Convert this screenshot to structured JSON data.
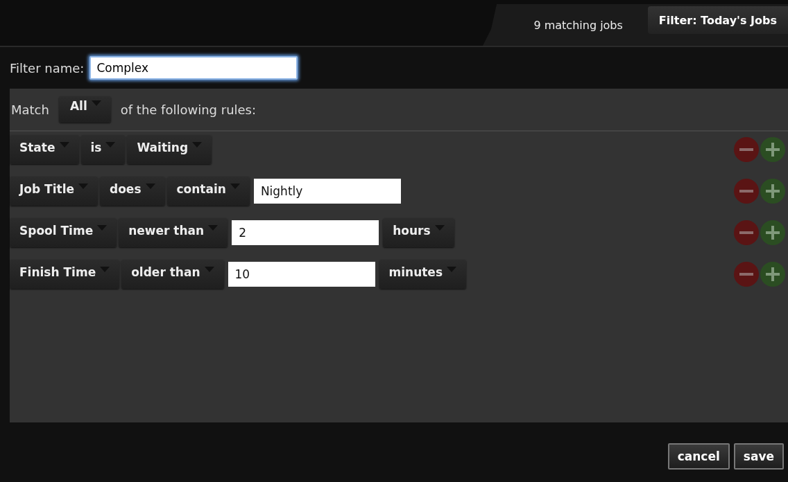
{
  "header": {
    "match_count": "9 matching jobs",
    "filter_menu": "Filter: Today's Jobs"
  },
  "filter_name": {
    "label": "Filter name:",
    "value": "Complex",
    "focused": true
  },
  "match": {
    "label": "Match",
    "mode": "All",
    "suffix": "of the following rules:"
  },
  "rules": [
    {
      "items": [
        {
          "kind": "dropdown",
          "text": "State"
        },
        {
          "kind": "dropdown",
          "text": "is"
        },
        {
          "kind": "dropdown",
          "text": "Waiting"
        }
      ]
    },
    {
      "items": [
        {
          "kind": "dropdown",
          "text": "Job Title"
        },
        {
          "kind": "dropdown",
          "text": "does"
        },
        {
          "kind": "dropdown",
          "text": "contain"
        },
        {
          "kind": "input",
          "text": "Nightly"
        }
      ]
    },
    {
      "items": [
        {
          "kind": "dropdown",
          "text": "Spool Time"
        },
        {
          "kind": "dropdown",
          "text": "newer than"
        },
        {
          "kind": "input",
          "text": "2"
        },
        {
          "kind": "dropdown",
          "text": "hours"
        }
      ]
    },
    {
      "items": [
        {
          "kind": "dropdown",
          "text": "Finish Time"
        },
        {
          "kind": "dropdown",
          "text": "older than"
        },
        {
          "kind": "input",
          "text": "10"
        },
        {
          "kind": "dropdown",
          "text": "minutes"
        }
      ]
    }
  ],
  "buttons": [
    "cancel",
    "save"
  ]
}
